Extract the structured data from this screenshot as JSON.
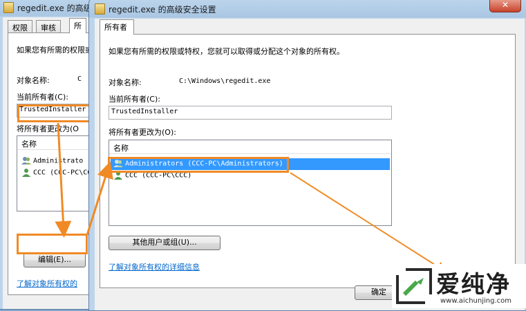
{
  "back_window": {
    "title": "regedit.exe 的高级安全设置",
    "tabs": [
      "权限",
      "审核",
      "所"
    ],
    "description": "如果您有所需的权限或特权",
    "object_name_label": "对象名称:",
    "object_name_value": "C",
    "current_owner_label": "当前所有者(C):",
    "current_owner_value": "TrustedInstaller",
    "change_owner_label": "将所有者更改为(O",
    "list_header": "名称",
    "list_items": [
      "Administrato",
      "CCC (CCC-PC\\CC"
    ],
    "edit_button": "编辑(E)...",
    "learn_link": "了解对象所有权的"
  },
  "front_window": {
    "title": "regedit.exe 的高级安全设置",
    "close_label": "✕",
    "tab": "所有者",
    "description": "如果您有所需的权限或特权，您就可以取得或分配这个对象的所有权。",
    "object_name_label": "对象名称:",
    "object_name_value": "C:\\Windows\\regedit.exe",
    "current_owner_label": "当前所有者(C):",
    "current_owner_value": "TrustedInstaller",
    "change_owner_label": "将所有者更改为(O):",
    "list_header": "名称",
    "list_items": [
      "Administrators (CCC-PC\\Administrators)",
      "CCC (CCC-PC\\CCC)"
    ],
    "other_users_button": "其他用户或组(U)...",
    "learn_link": "了解对象所有权的详细信息",
    "ok_button": "确定"
  },
  "watermark": {
    "brand": "爱纯净",
    "url": "www.aichunjing.com"
  },
  "colors": {
    "highlight": "#f08a24",
    "selection": "#3399ff",
    "link": "#0066cc"
  }
}
